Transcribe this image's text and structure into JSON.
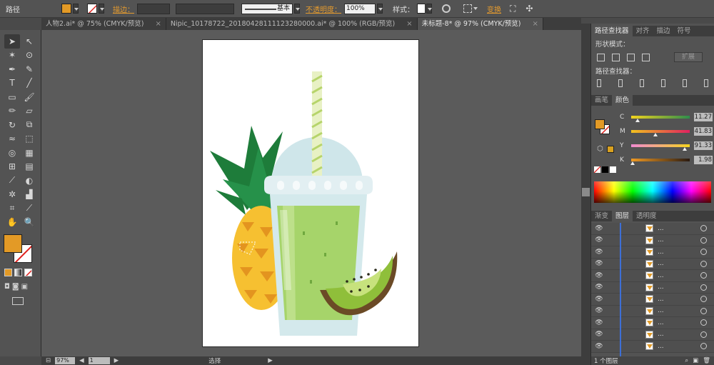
{
  "control_bar": {
    "object_type": "路径",
    "fill_color": "#e39a26",
    "stroke_label": "描边：",
    "stroke_profile": "基本",
    "opacity_label": "不透明度：",
    "opacity_value": "100%",
    "style_label": "样式：",
    "transform_label": "变换"
  },
  "tabs": [
    {
      "label": "人物2.ai* @ 75% (CMYK/预览)",
      "close": "×"
    },
    {
      "label": "Nipic_10178722_20180428111123280000.ai* @ 100% (RGB/预览)",
      "close": "×"
    },
    {
      "label": "未标题-8* @ 97% (CMYK/预览)",
      "close": "×"
    }
  ],
  "status_bar": {
    "zoom": "97%",
    "artboard_num": "1",
    "tool_name": "选择"
  },
  "pathfinder_panel": {
    "tabs": [
      "路径查找器",
      "对齐",
      "描边",
      "符号"
    ],
    "shape_modes_label": "形状模式：",
    "expand_label": "扩展",
    "pathfinders_label": "路径查找器："
  },
  "color_panel": {
    "tabs": [
      "画笔",
      "颜色"
    ],
    "channels": [
      {
        "name": "C",
        "value": "11.27",
        "fill": 0.11
      },
      {
        "name": "M",
        "value": "41.83",
        "fill": 0.42
      },
      {
        "name": "Y",
        "value": "91.33",
        "fill": 0.91
      },
      {
        "name": "K",
        "value": "1.98",
        "fill": 0.02
      }
    ],
    "current_color": "#e39a26"
  },
  "layers_panel": {
    "tabs": [
      "渐变",
      "图层",
      "透明度"
    ],
    "row_label": "...",
    "row_count": 11,
    "footer": "1 个图层"
  }
}
